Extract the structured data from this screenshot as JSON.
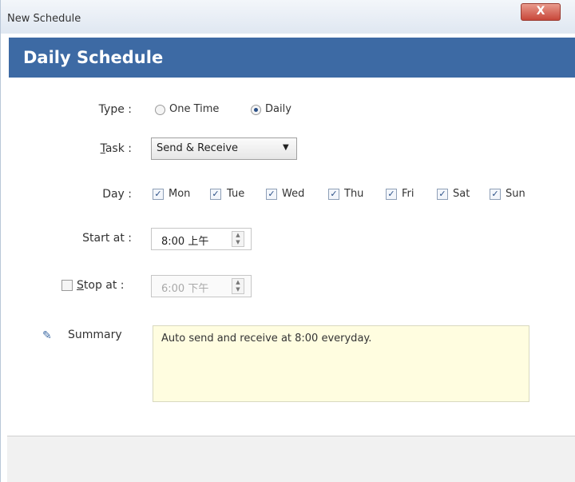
{
  "window": {
    "title": "New Schedule",
    "close_label": "X"
  },
  "header": {
    "title": "Daily Schedule"
  },
  "type_field": {
    "label": "Type :",
    "options": [
      {
        "label": "One Time",
        "selected": false
      },
      {
        "label": "Daily",
        "selected": true
      }
    ]
  },
  "task_field": {
    "label_first": "T",
    "label_rest": "ask :",
    "value": "Send & Receive"
  },
  "day_field": {
    "label": "Day :",
    "days": [
      {
        "label": "Mon",
        "checked": true
      },
      {
        "label": "Tue",
        "checked": true
      },
      {
        "label": "Wed",
        "checked": true
      },
      {
        "label": "Thu",
        "checked": true
      },
      {
        "label": "Fri",
        "checked": true
      },
      {
        "label": "Sat",
        "checked": true
      },
      {
        "label": "Sun",
        "checked": true
      }
    ]
  },
  "start_field": {
    "label": "Start at :",
    "value": "8:00 上午"
  },
  "stop_field": {
    "label_first": "S",
    "label_rest": "top at :",
    "checked": false,
    "value": "6:00 下午",
    "enabled": false
  },
  "summary": {
    "label": "Summary",
    "text": "Auto send and receive at 8:00 everyday."
  },
  "icons": {
    "checkmark": "✓",
    "radio": "radio-icon",
    "pin": "pin-icon",
    "dropdown": "chevron-down-icon"
  },
  "colors": {
    "header": "#3d6aa4",
    "summary_bg": "#fffde0",
    "close": "#c8473a"
  }
}
